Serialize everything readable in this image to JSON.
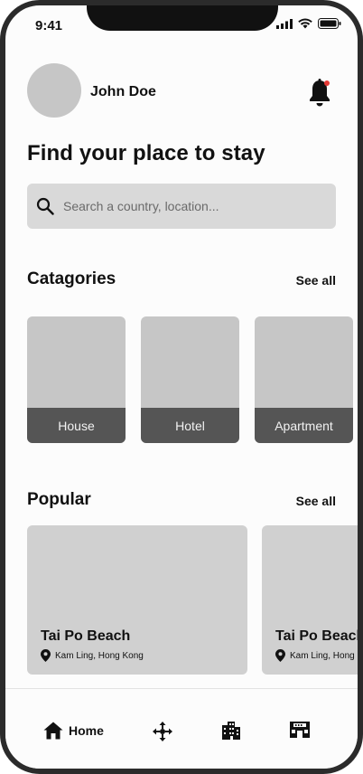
{
  "status_bar": {
    "time": "9:41"
  },
  "user": {
    "name": "John Doe"
  },
  "headline": "Find your place to stay",
  "search": {
    "placeholder": "Search a country, location..."
  },
  "categories": {
    "title": "Catagories",
    "see_all": "See all",
    "items": [
      {
        "label": "House"
      },
      {
        "label": "Hotel"
      },
      {
        "label": "Apartment"
      }
    ]
  },
  "popular": {
    "title": "Popular",
    "see_all": "See all",
    "items": [
      {
        "name": "Tai Po Beach",
        "location": "Kam Ling, Hong Kong"
      },
      {
        "name": "Tai Po Beach",
        "location": "Kam Ling, Hong Kong"
      }
    ]
  },
  "tabbar": {
    "items": [
      {
        "label": "Home",
        "icon": "home-icon",
        "active": true
      },
      {
        "label": "",
        "icon": "move-icon",
        "active": false
      },
      {
        "label": "",
        "icon": "city-icon",
        "active": false
      },
      {
        "label": "",
        "icon": "store-icon",
        "active": false
      }
    ]
  },
  "colors": {
    "notification_dot": "#e53935",
    "card_label_bg": "#555555",
    "search_bg": "#d9d9d9"
  }
}
